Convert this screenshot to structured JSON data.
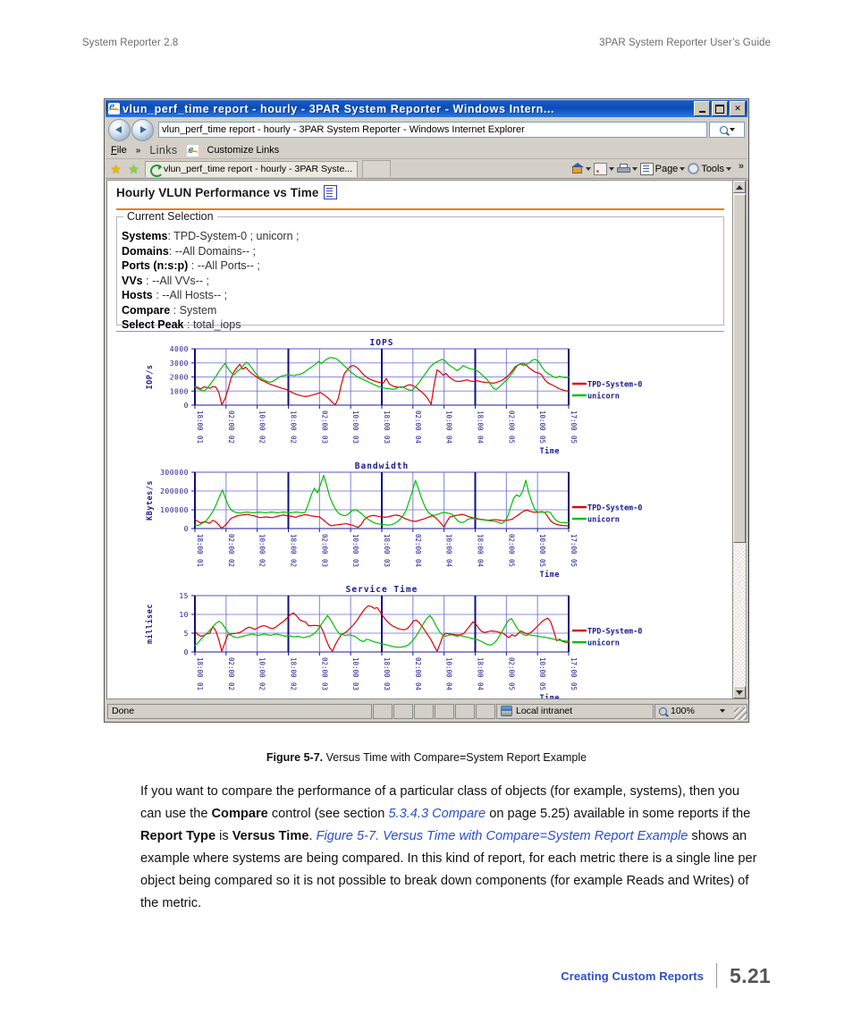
{
  "page_header": {
    "left": "System Reporter 2.8",
    "right": "3PAR System Reporter User’s Guide"
  },
  "browser": {
    "window_title": "vlun_perf_time report - hourly - 3PAR System Reporter - Windows Intern...",
    "window_buttons": {
      "minimize": "–",
      "maximize": "□",
      "close": "✕"
    },
    "address_value": "vlun_perf_time report - hourly - 3PAR System Reporter - Windows Internet Explorer",
    "menu": {
      "file": "File",
      "overflow": "»",
      "links_label": "Links",
      "customize_links": "Customize Links"
    },
    "tab_label": "vlun_perf_time report - hourly - 3PAR Syste...",
    "commands": {
      "home": "",
      "feeds": "",
      "print": "",
      "page": "Page",
      "tools": "Tools",
      "overflow": "»"
    },
    "status": {
      "text": "Done",
      "zone": "Local intranet",
      "zoom": "100%"
    }
  },
  "report": {
    "title": "Hourly VLUN Performance vs Time",
    "selection_legend": "Current Selection",
    "selection": [
      {
        "label": "Systems",
        "sep": ":",
        "value": "TPD-System-0 ; unicorn ;"
      },
      {
        "label": "Domains",
        "sep": ":",
        "value": "--All Domains-- ;"
      },
      {
        "label": "Ports (n:s:p)",
        "sep": ":",
        "value": "--All Ports-- ;"
      },
      {
        "label": "VVs",
        "sep": ":",
        "value": "--All VVs-- ;"
      },
      {
        "label": "Hosts",
        "sep": ":",
        "value": "--All Hosts-- ;"
      },
      {
        "label": "Compare",
        "sep": ":",
        "value": "System"
      },
      {
        "label": "Select Peak",
        "sep": ":",
        "value": "total_iops"
      }
    ]
  },
  "chart_data": [
    {
      "type": "line",
      "title": "IOPS",
      "xlabel": "Time",
      "ylabel": "IOP/s",
      "ylim": [
        0,
        4000
      ],
      "yticks": [
        0,
        1000,
        2000,
        3000,
        4000
      ],
      "ytick_labels": [
        "0",
        "1000",
        "2000",
        "3000",
        "4000"
      ],
      "grid": true,
      "legend_position": "right",
      "xtick_labels": [
        "01 18:00",
        "02 02:00",
        "02 10:00",
        "02 18:00",
        "03 02:00",
        "03 10:00",
        "03 18:00",
        "04 02:00",
        "04 10:00",
        "04 18:00",
        "05 02:00",
        "05 10:00",
        "05 17:00"
      ],
      "series": [
        {
          "name": "TPD-System-0",
          "color": "#e00000",
          "values": [
            1350,
            1250,
            1150,
            1300,
            1250,
            1200,
            1320,
            1280,
            900,
            20,
            420,
            1050,
            1850,
            2350,
            2650,
            2900,
            2550,
            2700,
            2450,
            2250,
            2100,
            1950,
            1800,
            1700,
            1600,
            1500,
            1420,
            1350,
            1280,
            1200,
            1150,
            1080,
            950,
            850,
            760,
            700,
            640,
            620,
            640,
            700,
            760,
            820,
            900,
            760,
            600,
            420,
            180,
            30,
            520,
            1500,
            2250,
            2500,
            2750,
            2820,
            2700,
            2500,
            2250,
            2050,
            1900,
            1800,
            1720,
            1650,
            1600,
            1560,
            1900,
            1500,
            1380,
            1300,
            1280,
            1260,
            1300,
            1400,
            1450,
            1380,
            1260,
            1080,
            900,
            700,
            420,
            60,
            1450,
            2500,
            2350,
            2120,
            2250,
            2000,
            1850,
            1720,
            1680,
            1700,
            1750,
            1800,
            1720,
            1680,
            1740,
            1700,
            1650,
            1620,
            1600,
            1580,
            1560,
            1620,
            1700,
            1800,
            1950,
            2150,
            2400,
            2700,
            2850,
            2900,
            2950,
            2800,
            2600,
            2450,
            2320,
            2280,
            2150,
            1800,
            1600,
            1480,
            1380,
            1260,
            1150,
            1080,
            1020,
            1000
          ]
        },
        {
          "name": "unicorn",
          "color": "#00c000",
          "values": [
            1300,
            1150,
            1050,
            1000,
            1180,
            1450,
            1750,
            2050,
            2400,
            2700,
            2950,
            2600,
            2300,
            2150,
            2400,
            2550,
            2800,
            3050,
            2900,
            2600,
            2300,
            2050,
            1900,
            1780,
            1680,
            1620,
            1700,
            1850,
            2000,
            2080,
            2120,
            2150,
            2120,
            2100,
            2150,
            2200,
            2300,
            2450,
            2600,
            2750,
            2900,
            3100,
            2950,
            3150,
            3300,
            3380,
            3350,
            3280,
            3100,
            2900,
            2700,
            2500,
            2300,
            2150,
            2000,
            1900,
            1800,
            1700,
            1600,
            1500,
            1400,
            1320,
            1250,
            1200,
            1180,
            1150,
            1120,
            1200,
            1300,
            1280,
            1160,
            1080,
            1040,
            1250,
            1500,
            1800,
            2100,
            2400,
            2700,
            2900,
            3050,
            3150,
            3250,
            3150,
            2900,
            2750,
            2600,
            2450,
            2600,
            2800,
            2700,
            2600,
            2550,
            2500,
            2400,
            2200,
            2000,
            1800,
            1500,
            1200,
            1100,
            1300,
            1500,
            1700,
            1900,
            2200,
            2500,
            2800,
            2950,
            2800,
            2900,
            3000,
            3200,
            3250,
            3100,
            2750,
            2450,
            2250,
            2150,
            2000,
            1950,
            2050,
            1980,
            1950,
            2000
          ]
        }
      ]
    },
    {
      "type": "line",
      "title": "Bandwidth",
      "xlabel": "Time",
      "ylabel": "KBytes/s",
      "ylim": [
        0,
        300000
      ],
      "yticks": [
        0,
        100000,
        200000,
        300000
      ],
      "ytick_labels": [
        "0",
        "100000",
        "200000",
        "300000"
      ],
      "grid": true,
      "legend_position": "right",
      "xtick_labels": [
        "01 18:00",
        "02 02:00",
        "02 10:00",
        "02 18:00",
        "03 02:00",
        "03 10:00",
        "03 18:00",
        "04 02:00",
        "04 10:00",
        "04 18:00",
        "05 02:00",
        "05 10:00",
        "05 17:00"
      ],
      "series": [
        {
          "name": "TPD-System-0",
          "color": "#e00000",
          "values": [
            48000,
            38000,
            30000,
            36000,
            34000,
            28000,
            44000,
            36000,
            20000,
            2000,
            14000,
            30000,
            52000,
            60000,
            66000,
            70000,
            72000,
            74000,
            76000,
            70000,
            68000,
            62000,
            58000,
            60000,
            62000,
            60000,
            58000,
            62000,
            66000,
            70000,
            72000,
            68000,
            66000,
            64000,
            60000,
            66000,
            70000,
            74000,
            72000,
            68000,
            66000,
            64000,
            62000,
            50000,
            36000,
            24000,
            14000,
            18000,
            20000,
            22000,
            24000,
            26000,
            22000,
            18000,
            12000,
            6000,
            20000,
            46000,
            60000,
            66000,
            70000,
            68000,
            64000,
            62000,
            60000,
            62000,
            66000,
            70000,
            72000,
            68000,
            60000,
            52000,
            46000,
            42000,
            38000,
            40000,
            46000,
            50000,
            56000,
            62000,
            68000,
            60000,
            44000,
            26000,
            8000,
            40000,
            62000,
            66000,
            70000,
            72000,
            76000,
            72000,
            66000,
            60000,
            56000,
            54000,
            50000,
            48000,
            46000,
            44000,
            46000,
            48000,
            46000,
            44000,
            42000,
            44000,
            46000,
            50000,
            62000,
            72000,
            84000,
            94000,
            98000,
            92000,
            88000,
            86000,
            88000,
            90000,
            86000,
            62000,
            40000,
            28000,
            22000,
            18000,
            16000,
            15000,
            14000
          ]
        },
        {
          "name": "unicorn",
          "color": "#00c000",
          "values": [
            20000,
            16000,
            24000,
            34000,
            48000,
            70000,
            96000,
            130000,
            170000,
            206000,
            160000,
            120000,
            96000,
            88000,
            84000,
            82000,
            86000,
            88000,
            86000,
            84000,
            86000,
            88000,
            86000,
            84000,
            86000,
            88000,
            86000,
            84000,
            86000,
            88000,
            86000,
            84000,
            86000,
            88000,
            86000,
            84000,
            86000,
            130000,
            180000,
            215000,
            190000,
            235000,
            284000,
            230000,
            170000,
            130000,
            100000,
            80000,
            72000,
            68000,
            76000,
            92000,
            100000,
            96000,
            84000,
            70000,
            56000,
            44000,
            34000,
            28000,
            24000,
            22000,
            20000,
            18000,
            20000,
            26000,
            36000,
            50000,
            70000,
            100000,
            150000,
            200000,
            256000,
            210000,
            160000,
            120000,
            90000,
            74000,
            70000,
            74000,
            80000,
            86000,
            84000,
            80000,
            76000,
            56000,
            38000,
            32000,
            36000,
            48000,
            54000,
            52000,
            50000,
            48000,
            46000,
            44000,
            42000,
            40000,
            38000,
            34000,
            26000,
            36000,
            60000,
            110000,
            160000,
            180000,
            170000,
            200000,
            258000,
            190000,
            140000,
            100000,
            86000,
            88000,
            86000,
            90000,
            86000,
            60000,
            42000,
            34000,
            30000,
            32000,
            30000
          ]
        }
      ]
    },
    {
      "type": "line",
      "title": "Service Time",
      "xlabel": "Time",
      "ylabel": "millisec",
      "ylim": [
        0,
        15
      ],
      "yticks": [
        0,
        5,
        10,
        15
      ],
      "ytick_labels": [
        "0",
        "5",
        "10",
        "15"
      ],
      "grid": true,
      "legend_position": "right",
      "xtick_labels": [
        "01 18:00",
        "02 02:00",
        "02 10:00",
        "02 18:00",
        "03 02:00",
        "03 10:00",
        "03 18:00",
        "04 02:00",
        "04 10:00",
        "04 18:00",
        "05 02:00",
        "05 10:00",
        "05 17:00"
      ],
      "series": [
        {
          "name": "TPD-System-0",
          "color": "#e00000",
          "values": [
            5.5,
            4.6,
            4.2,
            4.4,
            4.8,
            5.0,
            6.8,
            5.6,
            3.2,
            0.2,
            2.4,
            4.6,
            4.8,
            4.9,
            5.0,
            5.2,
            5.6,
            6.2,
            6.6,
            6.4,
            6.0,
            6.4,
            6.8,
            7.0,
            6.8,
            6.4,
            6.2,
            6.6,
            7.2,
            7.8,
            8.4,
            9.2,
            10.0,
            10.4,
            9.6,
            8.6,
            8.2,
            8.0,
            7.0,
            7.0,
            7.1,
            7.0,
            6.9,
            5.2,
            3.0,
            1.2,
            0.2,
            2.0,
            3.4,
            4.6,
            5.0,
            5.6,
            6.4,
            7.2,
            8.2,
            9.4,
            10.6,
            11.6,
            12.3,
            12.1,
            11.6,
            11.8,
            10.6,
            9.4,
            8.4,
            7.6,
            7.0,
            6.6,
            6.2,
            6.0,
            5.9,
            6.2,
            7.0,
            8.2,
            8.5,
            7.8,
            6.8,
            5.6,
            4.4,
            3.2,
            1.6,
            0.2,
            2.2,
            4.4,
            5.0,
            4.8,
            4.7,
            4.6,
            4.5,
            4.6,
            5.0,
            6.0,
            7.0,
            8.0,
            7.4,
            6.2,
            5.4,
            5.2,
            5.4,
            5.6,
            5.5,
            5.4,
            5.2,
            5.0,
            4.4,
            3.8,
            4.6,
            4.2,
            4.8,
            5.6,
            5.2,
            4.8,
            5.0,
            5.6,
            6.4,
            7.2,
            8.0,
            8.6,
            9.0,
            8.0,
            5.6,
            3.0,
            3.4,
            2.8,
            2.6,
            2.5
          ]
        },
        {
          "name": "unicorn",
          "color": "#00c000",
          "values": [
            1.7,
            2.4,
            3.4,
            4.2,
            5.0,
            5.8,
            6.8,
            7.6,
            8.2,
            7.6,
            6.4,
            5.2,
            4.4,
            4.0,
            3.8,
            4.0,
            4.2,
            4.4,
            4.6,
            4.8,
            4.6,
            4.4,
            4.6,
            4.8,
            4.6,
            4.4,
            4.6,
            4.8,
            4.6,
            4.4,
            4.2,
            4.4,
            4.2,
            4.0,
            4.2,
            4.0,
            3.8,
            4.0,
            4.2,
            4.6,
            5.2,
            6.2,
            7.4,
            8.6,
            9.7,
            8.6,
            7.2,
            5.8,
            4.8,
            4.6,
            4.4,
            4.6,
            4.4,
            4.2,
            3.6,
            3.0,
            2.8,
            3.4,
            3.2,
            2.8,
            2.6,
            2.4,
            2.2,
            2.0,
            1.8,
            1.6,
            1.4,
            1.3,
            1.2,
            1.4,
            1.6,
            2.0,
            2.8,
            3.8,
            5.0,
            6.4,
            7.8,
            9.0,
            9.7,
            8.6,
            7.0,
            5.6,
            4.6,
            4.2,
            4.4,
            4.6,
            4.4,
            4.2,
            4.4,
            4.2,
            4.0,
            3.8,
            3.6,
            3.4,
            3.2,
            2.8,
            2.4,
            2.0,
            1.8,
            2.2,
            3.0,
            4.2,
            5.6,
            7.0,
            8.4,
            8.9,
            7.6,
            6.2,
            5.2,
            4.6,
            4.4,
            4.6,
            4.4,
            4.3,
            4.2,
            4.0,
            3.9,
            3.8,
            3.6,
            3.4,
            3.2,
            3.1,
            3.0,
            2.9,
            2.9
          ]
        }
      ]
    }
  ],
  "figure": {
    "caption_label": "Figure 5-7.",
    "caption_text": "Versus Time with Compare=System Report Example"
  },
  "body": {
    "p1_a": "If you want to compare the performance of a particular class of objects (for example, systems), then you can use the ",
    "p1_b": "Compare",
    "p1_c": " control (see section ",
    "p1_link1": "5.3.4.3 Compare",
    "p1_d": " on page 5.25) available in some reports if the ",
    "p1_e": "Report Type",
    "p1_f": " is ",
    "p1_g": "Versus Time",
    "p1_h": ". ",
    "p1_link2": "Figure 5-7. Versus Time with Compare=System Report Example",
    "p1_i": " shows an example where systems are being compared. In this kind of report, for each metric there is a single line per object being compared so it is not possible to break down components (for example Reads and Writes) of the metric."
  },
  "footer": {
    "section": "Creating Custom Reports",
    "page_number": "5.21"
  }
}
